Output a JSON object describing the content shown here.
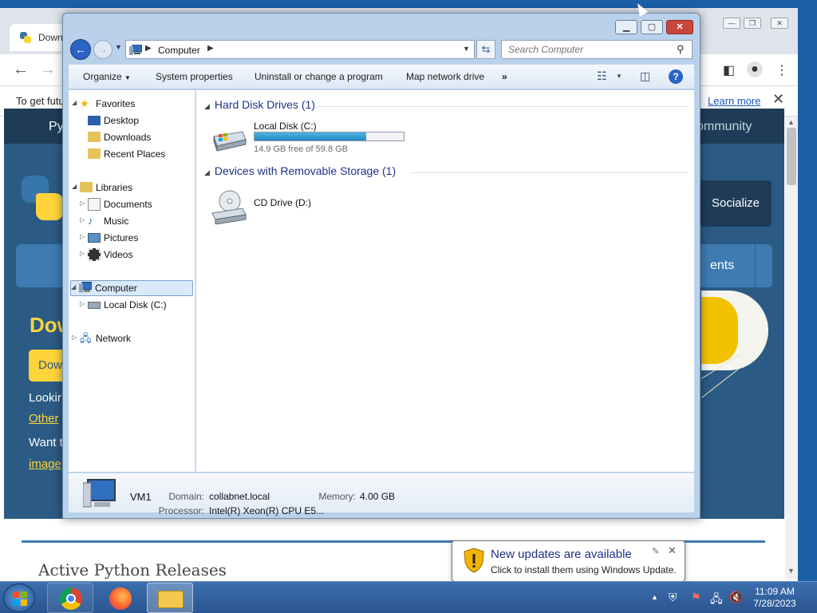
{
  "browser": {
    "tab_title": "Down",
    "banner_text": "To get futu",
    "learn_more": "Learn more"
  },
  "site": {
    "nav_left": "Py",
    "nav_right": "ommunity",
    "socialize": "Socialize",
    "band_right": "ents",
    "heading": "Dow",
    "download_button": "Dow",
    "looking": "Lookir",
    "other_link": "Other",
    "want": "Want t",
    "image_link": "image",
    "active_releases": "Active Python Releases"
  },
  "explorer": {
    "address": "Computer",
    "search_placeholder": "Search Computer",
    "commands": {
      "organize": "Organize",
      "system_properties": "System properties",
      "uninstall": "Uninstall or change a program",
      "map_drive": "Map network drive",
      "more": "»"
    },
    "nav": {
      "favorites": "Favorites",
      "desktop": "Desktop",
      "downloads": "Downloads",
      "recent": "Recent Places",
      "libraries": "Libraries",
      "documents": "Documents",
      "music": "Music",
      "pictures": "Pictures",
      "videos": "Videos",
      "computer": "Computer",
      "local_disk": "Local Disk (C:)",
      "network": "Network"
    },
    "groups": {
      "hdd": "Hard Disk Drives (1)",
      "removable": "Devices with Removable Storage (1)"
    },
    "drive_c": {
      "name": "Local Disk (C:)",
      "free": "14.9 GB free of 59.8 GB",
      "used_fraction": 0.75
    },
    "drive_d": {
      "name": "CD Drive (D:)"
    },
    "details": {
      "name": "VM1",
      "domain_label": "Domain:",
      "domain": "collabnet.local",
      "memory_label": "Memory:",
      "memory": "4.00 GB",
      "processor_label": "Processor:",
      "processor": "Intel(R) Xeon(R) CPU E5..."
    }
  },
  "balloon": {
    "title": "New updates are available",
    "text": "Click to install them using Windows Update."
  },
  "clock": {
    "time": "11:09 AM",
    "date": "7/28/2023"
  },
  "icons": {
    "favorites": "star-icon",
    "folder": "folder-icon",
    "computer": "computer-icon",
    "network": "network-icon"
  },
  "colors": {
    "accent": "#2a64c4",
    "group_heading": "#1e3287",
    "drive_bar": "#2688c4",
    "python_yellow": "#ffd43b",
    "python_blue": "#2b5b84"
  }
}
